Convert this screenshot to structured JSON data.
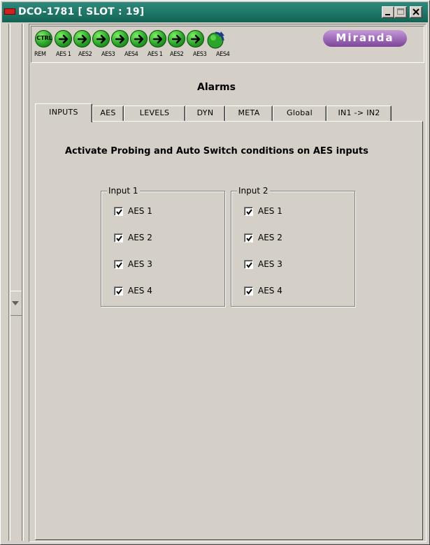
{
  "window": {
    "title": "DCO-1781 [ SLOT : 19]",
    "title_bar_color": "#1f7768",
    "controls": [
      "minimize-icon",
      "maximize-icon",
      "close-icon"
    ]
  },
  "status": {
    "leds": [
      {
        "label": "REM",
        "icon": "ctrl-led",
        "text": "CTRL",
        "color": "#2aa52a"
      },
      {
        "label": "AES 1",
        "icon": "arrow-right-led",
        "color": "#2aa52a"
      },
      {
        "label": "AES2",
        "icon": "arrow-right-led",
        "color": "#2aa52a"
      },
      {
        "label": "AES3",
        "icon": "arrow-right-led",
        "color": "#2aa52a"
      },
      {
        "label": "AES4",
        "icon": "arrow-right-led",
        "color": "#2aa52a"
      },
      {
        "label": "AES 1",
        "icon": "arrow-right-led",
        "color": "#2aa52a"
      },
      {
        "label": "AES2",
        "icon": "arrow-right-led",
        "color": "#2aa52a"
      },
      {
        "label": "AES3",
        "icon": "arrow-right-led",
        "color": "#2aa52a"
      },
      {
        "label": "AES4",
        "icon": "arrow-right-led",
        "color": "#2aa52a"
      },
      {
        "label": "",
        "icon": "rotate-led",
        "color": "#2aa52a"
      }
    ],
    "logo": "Miranda",
    "logo_color": "#a06cba"
  },
  "panel": {
    "heading": "Alarms",
    "tabs": [
      {
        "label": "INPUTS",
        "active": true
      },
      {
        "label": "AES",
        "active": false
      },
      {
        "label": "LEVELS",
        "active": false
      },
      {
        "label": "DYN",
        "active": false
      },
      {
        "label": "META",
        "active": false
      },
      {
        "label": "Global",
        "active": false
      },
      {
        "label": "IN1 -> IN2",
        "active": false
      }
    ],
    "subtitle": "Activate Probing and Auto Switch conditions on AES inputs",
    "groups": [
      {
        "title": "Input 1",
        "items": [
          {
            "label": "AES 1",
            "checked": true
          },
          {
            "label": "AES 2",
            "checked": true
          },
          {
            "label": "AES 3",
            "checked": true
          },
          {
            "label": "AES 4",
            "checked": true
          }
        ]
      },
      {
        "title": "Input 2",
        "items": [
          {
            "label": "AES 1",
            "checked": true
          },
          {
            "label": "AES 2",
            "checked": true
          },
          {
            "label": "AES 3",
            "checked": true
          },
          {
            "label": "AES 4",
            "checked": true
          }
        ]
      }
    ]
  }
}
